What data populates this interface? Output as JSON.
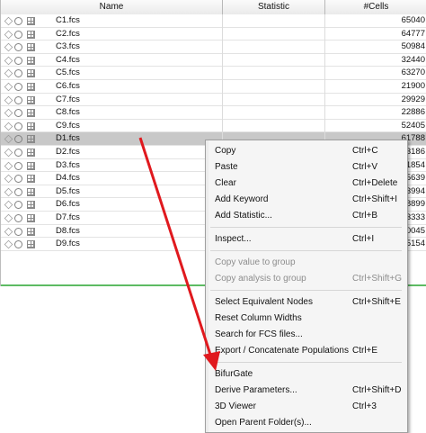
{
  "table": {
    "columns": [
      "Name",
      "Statistic",
      "#Cells"
    ],
    "rows": [
      {
        "name": "C1.fcs",
        "cells": "65040"
      },
      {
        "name": "C2.fcs",
        "cells": "64777"
      },
      {
        "name": "C3.fcs",
        "cells": "50984"
      },
      {
        "name": "C4.fcs",
        "cells": "32440"
      },
      {
        "name": "C5.fcs",
        "cells": "63270"
      },
      {
        "name": "C6.fcs",
        "cells": "21900"
      },
      {
        "name": "C7.fcs",
        "cells": "29929"
      },
      {
        "name": "C8.fcs",
        "cells": "22886"
      },
      {
        "name": "C9.fcs",
        "cells": "52405"
      },
      {
        "name": "D1.fcs",
        "cells": "61788"
      },
      {
        "name": "D2.fcs",
        "cells": "3186"
      },
      {
        "name": "D3.fcs",
        "cells": "1854"
      },
      {
        "name": "D4.fcs",
        "cells": "5639"
      },
      {
        "name": "D5.fcs",
        "cells": "3994"
      },
      {
        "name": "D6.fcs",
        "cells": "8899"
      },
      {
        "name": "D7.fcs",
        "cells": "3333"
      },
      {
        "name": "D8.fcs",
        "cells": "0045"
      },
      {
        "name": "D9.fcs",
        "cells": "5154"
      }
    ],
    "selected_row": "D1.fcs"
  },
  "context_menu": {
    "items": [
      {
        "label": "Copy",
        "shortcut": "Ctrl+C"
      },
      {
        "label": "Paste",
        "shortcut": "Ctrl+V"
      },
      {
        "label": "Clear",
        "shortcut": "Ctrl+Delete"
      },
      {
        "label": "Add Keyword",
        "shortcut": "Ctrl+Shift+I"
      },
      {
        "label": "Add Statistic...",
        "shortcut": "Ctrl+B"
      },
      {
        "label": "Inspect...",
        "shortcut": "Ctrl+I"
      },
      {
        "label": "Copy value to group",
        "shortcut": "",
        "disabled": true
      },
      {
        "label": "Copy analysis to group",
        "shortcut": "Ctrl+Shift+G",
        "disabled": true
      },
      {
        "label": "Select Equivalent Nodes",
        "shortcut": "Ctrl+Shift+E"
      },
      {
        "label": "Reset Column Widths",
        "shortcut": ""
      },
      {
        "label": "Search for FCS files...",
        "shortcut": ""
      },
      {
        "label": "Export / Concatenate Populations",
        "shortcut": "Ctrl+E"
      },
      {
        "label": "BifurGate",
        "shortcut": ""
      },
      {
        "label": "Derive Parameters...",
        "shortcut": "Ctrl+Shift+D"
      },
      {
        "label": "3D Viewer",
        "shortcut": "Ctrl+3"
      },
      {
        "label": "Open Parent Folder(s)...",
        "shortcut": ""
      }
    ]
  },
  "colors": {
    "annotation_arrow": "#e0191e",
    "selected_row": "#c8c8c8",
    "separator_line": "#5dbb63"
  }
}
